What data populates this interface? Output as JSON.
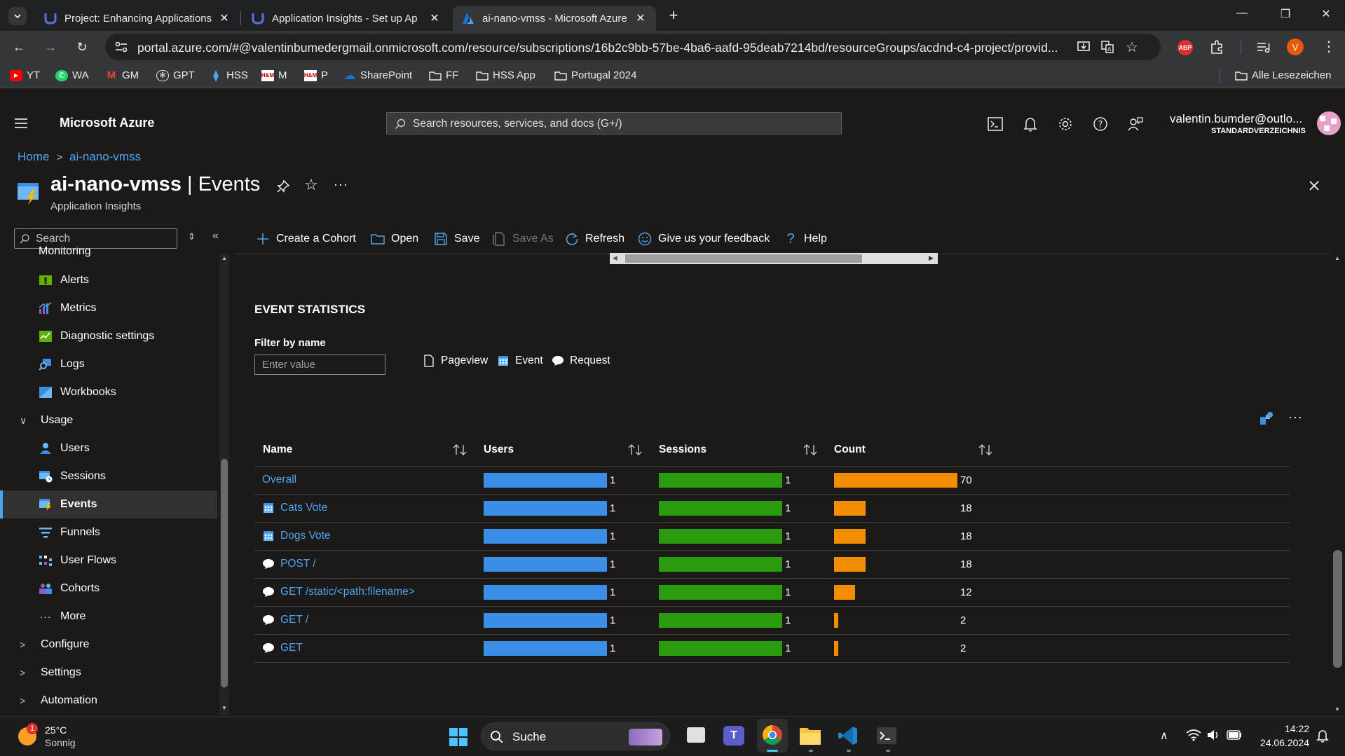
{
  "browser": {
    "tabs": [
      {
        "title": "Project: Enhancing Applications",
        "icon": "udacity-icon"
      },
      {
        "title": "Application Insights - Set up Ap",
        "icon": "udacity-icon"
      },
      {
        "title": "ai-nano-vmss - Microsoft Azure",
        "icon": "azure-icon",
        "active": true
      }
    ],
    "url": "portal.azure.com/#@valentinbumedergmail.onmicrosoft.com/resource/subscriptions/16b2c9bb-57be-4ba6-aafd-95deab7214bd/resourceGroups/acdnd-c4-project/provid...",
    "profile_initial": "V",
    "extension_abp": "ABP",
    "bookmarks": [
      {
        "label": "YT",
        "color": "#ff0000"
      },
      {
        "label": "WA",
        "color": "#25d366"
      },
      {
        "label": "GM",
        "color": "#ea4335"
      },
      {
        "label": "GPT",
        "color": "#e8eaed"
      },
      {
        "label": "HSS",
        "color": "#4ca3f0"
      },
      {
        "label": "M",
        "color": "#c00"
      },
      {
        "label": "P",
        "color": "#c00"
      },
      {
        "label": "SharePoint",
        "color": "#0f78d4"
      },
      {
        "label": "FF",
        "color": "#e8eaed"
      },
      {
        "label": "HSS App",
        "color": "#e8eaed"
      },
      {
        "label": "Portugal 2024",
        "color": "#e8eaed"
      }
    ],
    "all_bookmarks": "Alle Lesezeichen"
  },
  "azure": {
    "brand": "Microsoft Azure",
    "search_placeholder": "Search resources, services, and docs (G+/)",
    "account_name": "valentin.bumder@outlo...",
    "account_directory": "STANDARDVERZEICHNIS"
  },
  "breadcrumb": {
    "home": "Home",
    "resource": "ai-nano-vmss"
  },
  "blade": {
    "resource_name": "ai-nano-vmss",
    "separator": "|",
    "page": "Events",
    "subtitle": "Application Insights"
  },
  "nav": {
    "search_placeholder": "Search",
    "cut_group": "Monitoring",
    "items": [
      {
        "label": "Alerts",
        "icon": "alerts-icon"
      },
      {
        "label": "Metrics",
        "icon": "metrics-icon"
      },
      {
        "label": "Diagnostic settings",
        "icon": "diagnostic-icon"
      },
      {
        "label": "Logs",
        "icon": "logs-icon"
      },
      {
        "label": "Workbooks",
        "icon": "workbooks-icon"
      }
    ],
    "usage_group": "Usage",
    "usage_items": [
      {
        "label": "Users",
        "icon": "users-icon"
      },
      {
        "label": "Sessions",
        "icon": "sessions-icon"
      },
      {
        "label": "Events",
        "icon": "events-icon",
        "selected": true
      },
      {
        "label": "Funnels",
        "icon": "funnels-icon"
      },
      {
        "label": "User Flows",
        "icon": "userflows-icon"
      },
      {
        "label": "Cohorts",
        "icon": "cohorts-icon"
      },
      {
        "label": "More",
        "icon": "more-icon"
      }
    ],
    "collapsed_groups": [
      "Configure",
      "Settings",
      "Automation"
    ]
  },
  "commands": [
    {
      "label": "Create a Cohort",
      "icon": "plus-icon"
    },
    {
      "label": "Open",
      "icon": "folder-icon"
    },
    {
      "label": "Save",
      "icon": "save-icon"
    },
    {
      "label": "Save As",
      "icon": "save-as-icon",
      "disabled": true
    },
    {
      "label": "Refresh",
      "icon": "refresh-icon"
    },
    {
      "label": "Give us your feedback",
      "icon": "smiley-icon"
    },
    {
      "label": "Help",
      "icon": "help-icon"
    }
  ],
  "event_statistics": {
    "heading": "EVENT STATISTICS",
    "filter_label": "Filter by name",
    "filter_placeholder": "Enter value",
    "legend": [
      {
        "label": "Pageview",
        "icon": "page-icon"
      },
      {
        "label": "Event",
        "icon": "calendar-icon"
      },
      {
        "label": "Request",
        "icon": "chat-icon"
      }
    ],
    "columns": [
      "Name",
      "Users",
      "Sessions",
      "Count"
    ],
    "bar_colors": {
      "users": "#3a8ee6",
      "sessions": "#2a9d0e",
      "count": "#f28c00"
    },
    "rows": [
      {
        "name": "Overall",
        "icon": "",
        "users": "1",
        "sessions": "1",
        "count": "70",
        "users_fill": 1.0,
        "sessions_fill": 1.0,
        "count_fill": 1.0
      },
      {
        "name": "Cats Vote",
        "icon": "calendar-icon",
        "users": "1",
        "sessions": "1",
        "count": "18",
        "users_fill": 1.0,
        "sessions_fill": 1.0,
        "count_fill": 0.257
      },
      {
        "name": "Dogs Vote",
        "icon": "calendar-icon",
        "users": "1",
        "sessions": "1",
        "count": "18",
        "users_fill": 1.0,
        "sessions_fill": 1.0,
        "count_fill": 0.257
      },
      {
        "name": "POST /",
        "icon": "chat-icon",
        "users": "1",
        "sessions": "1",
        "count": "18",
        "users_fill": 1.0,
        "sessions_fill": 1.0,
        "count_fill": 0.257
      },
      {
        "name": "GET /static/<path:filename>",
        "icon": "chat-icon",
        "users": "1",
        "sessions": "1",
        "count": "12",
        "users_fill": 1.0,
        "sessions_fill": 1.0,
        "count_fill": 0.171
      },
      {
        "name": "GET /",
        "icon": "chat-icon",
        "users": "1",
        "sessions": "1",
        "count": "2",
        "users_fill": 1.0,
        "sessions_fill": 1.0,
        "count_fill": 0.029
      },
      {
        "name": "GET",
        "icon": "chat-icon",
        "users": "1",
        "sessions": "1",
        "count": "2",
        "users_fill": 1.0,
        "sessions_fill": 1.0,
        "count_fill": 0.029
      }
    ]
  },
  "taskbar": {
    "weather_temp": "25°C",
    "weather_desc": "Sonnig",
    "weather_badge": "1",
    "search_label": "Suche",
    "time": "14:22",
    "date": "24.06.2024"
  }
}
